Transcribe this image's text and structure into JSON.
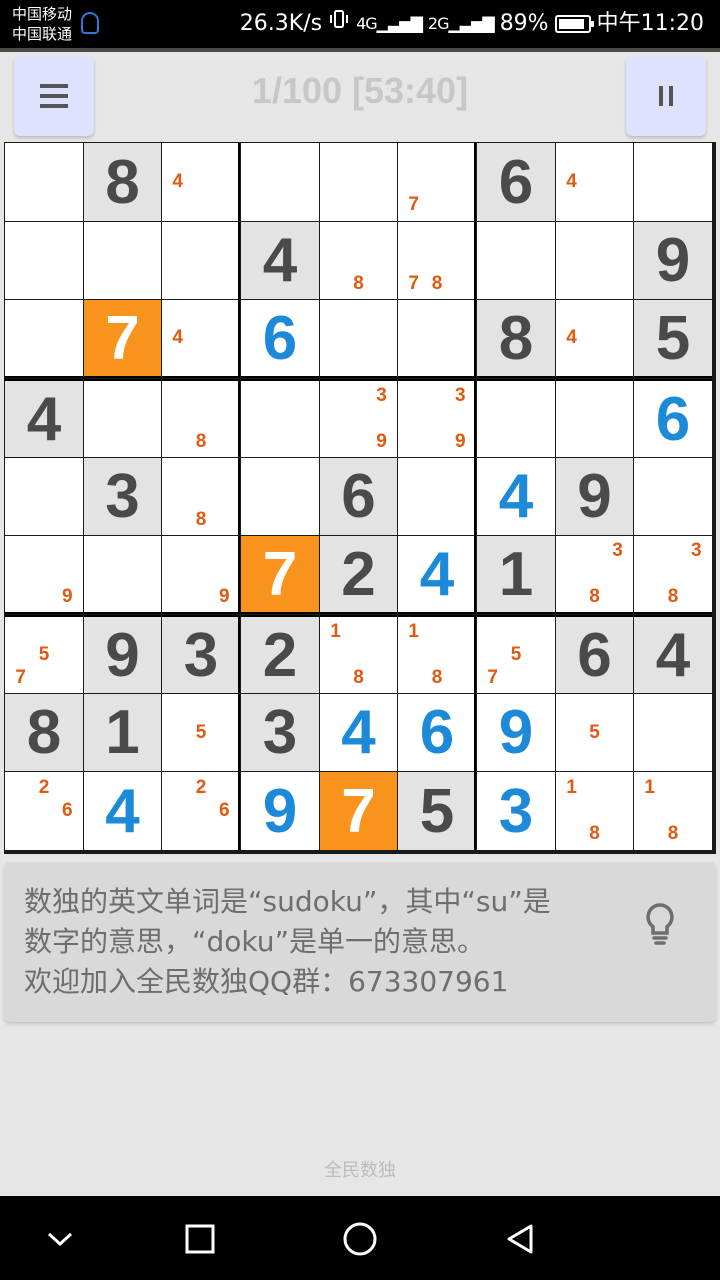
{
  "status_bar": {
    "carrier_1": "中国移动",
    "carrier_2": "中国联通",
    "speed": "26.3K/s",
    "net_1": "4G",
    "net_2": "2G",
    "battery": "89%",
    "battery_level": 0.89,
    "time": "中午11:20"
  },
  "header": {
    "menu_icon": "menu-icon",
    "pause_icon": "pause-icon",
    "title": "1/100 [53:40]"
  },
  "board": {
    "rows": [
      [
        {
          "v": "",
          "t": "empty",
          "n": []
        },
        {
          "v": "8",
          "t": "given",
          "n": []
        },
        {
          "v": "",
          "t": "empty",
          "n": [
            {
              "p": 4,
              "d": "4"
            }
          ]
        },
        {
          "v": "",
          "t": "empty",
          "n": []
        },
        {
          "v": "",
          "t": "empty",
          "n": []
        },
        {
          "v": "",
          "t": "empty",
          "n": [
            {
              "p": 7,
              "d": "7"
            }
          ]
        },
        {
          "v": "6",
          "t": "given",
          "n": []
        },
        {
          "v": "",
          "t": "empty",
          "n": [
            {
              "p": 4,
              "d": "4"
            }
          ]
        },
        {
          "v": "",
          "t": "empty",
          "n": []
        }
      ],
      [
        {
          "v": "",
          "t": "empty",
          "n": []
        },
        {
          "v": "",
          "t": "empty",
          "n": []
        },
        {
          "v": "",
          "t": "empty",
          "n": []
        },
        {
          "v": "4",
          "t": "given",
          "n": []
        },
        {
          "v": "",
          "t": "empty",
          "n": [
            {
              "p": 8,
              "d": "8"
            }
          ]
        },
        {
          "v": "",
          "t": "empty",
          "n": [
            {
              "p": 7,
              "d": "7"
            },
            {
              "p": 8,
              "d": "8"
            }
          ]
        },
        {
          "v": "",
          "t": "empty",
          "n": []
        },
        {
          "v": "",
          "t": "empty",
          "n": []
        },
        {
          "v": "9",
          "t": "given",
          "n": []
        }
      ],
      [
        {
          "v": "",
          "t": "empty",
          "n": []
        },
        {
          "v": "7",
          "t": "highlight",
          "n": []
        },
        {
          "v": "",
          "t": "empty",
          "n": [
            {
              "p": 4,
              "d": "4"
            }
          ]
        },
        {
          "v": "6",
          "t": "user",
          "n": []
        },
        {
          "v": "",
          "t": "empty",
          "n": []
        },
        {
          "v": "",
          "t": "empty",
          "n": []
        },
        {
          "v": "8",
          "t": "given",
          "n": []
        },
        {
          "v": "",
          "t": "empty",
          "n": [
            {
              "p": 4,
              "d": "4"
            }
          ]
        },
        {
          "v": "5",
          "t": "given",
          "n": []
        }
      ],
      [
        {
          "v": "4",
          "t": "given",
          "n": []
        },
        {
          "v": "",
          "t": "empty",
          "n": []
        },
        {
          "v": "",
          "t": "empty",
          "n": [
            {
              "p": 8,
              "d": "8"
            }
          ]
        },
        {
          "v": "",
          "t": "empty",
          "n": []
        },
        {
          "v": "",
          "t": "empty",
          "n": [
            {
              "p": 3,
              "d": "3"
            },
            {
              "p": 9,
              "d": "9"
            }
          ]
        },
        {
          "v": "",
          "t": "empty",
          "n": [
            {
              "p": 3,
              "d": "3"
            },
            {
              "p": 9,
              "d": "9"
            }
          ]
        },
        {
          "v": "",
          "t": "empty",
          "n": []
        },
        {
          "v": "",
          "t": "empty",
          "n": []
        },
        {
          "v": "6",
          "t": "user",
          "n": []
        }
      ],
      [
        {
          "v": "",
          "t": "empty",
          "n": []
        },
        {
          "v": "3",
          "t": "given",
          "n": []
        },
        {
          "v": "",
          "t": "empty",
          "n": [
            {
              "p": 8,
              "d": "8"
            }
          ]
        },
        {
          "v": "",
          "t": "empty",
          "n": []
        },
        {
          "v": "6",
          "t": "given",
          "n": []
        },
        {
          "v": "",
          "t": "empty",
          "n": []
        },
        {
          "v": "4",
          "t": "user",
          "n": []
        },
        {
          "v": "9",
          "t": "given",
          "n": []
        },
        {
          "v": "",
          "t": "empty",
          "n": []
        }
      ],
      [
        {
          "v": "",
          "t": "empty",
          "n": [
            {
              "p": 9,
              "d": "9"
            }
          ]
        },
        {
          "v": "",
          "t": "empty",
          "n": []
        },
        {
          "v": "",
          "t": "empty",
          "n": [
            {
              "p": 9,
              "d": "9"
            }
          ]
        },
        {
          "v": "7",
          "t": "highlight",
          "n": []
        },
        {
          "v": "2",
          "t": "given",
          "n": []
        },
        {
          "v": "4",
          "t": "user",
          "n": []
        },
        {
          "v": "1",
          "t": "given",
          "n": []
        },
        {
          "v": "",
          "t": "empty",
          "n": [
            {
              "p": 3,
              "d": "3"
            },
            {
              "p": 8,
              "d": "8"
            }
          ]
        },
        {
          "v": "",
          "t": "empty",
          "n": [
            {
              "p": 3,
              "d": "3"
            },
            {
              "p": 8,
              "d": "8"
            }
          ]
        }
      ],
      [
        {
          "v": "",
          "t": "empty",
          "n": [
            {
              "p": 5,
              "d": "5"
            },
            {
              "p": 7,
              "d": "7"
            }
          ]
        },
        {
          "v": "9",
          "t": "given",
          "n": []
        },
        {
          "v": "3",
          "t": "given",
          "n": []
        },
        {
          "v": "2",
          "t": "given",
          "n": []
        },
        {
          "v": "",
          "t": "empty",
          "n": [
            {
              "p": 1,
              "d": "1"
            },
            {
              "p": 8,
              "d": "8"
            }
          ]
        },
        {
          "v": "",
          "t": "empty",
          "n": [
            {
              "p": 1,
              "d": "1"
            },
            {
              "p": 8,
              "d": "8"
            }
          ]
        },
        {
          "v": "",
          "t": "empty",
          "n": [
            {
              "p": 5,
              "d": "5"
            },
            {
              "p": 7,
              "d": "7"
            }
          ]
        },
        {
          "v": "6",
          "t": "given",
          "n": []
        },
        {
          "v": "4",
          "t": "given",
          "n": []
        }
      ],
      [
        {
          "v": "8",
          "t": "given",
          "n": []
        },
        {
          "v": "1",
          "t": "given",
          "n": []
        },
        {
          "v": "",
          "t": "empty",
          "n": [
            {
              "p": 5,
              "d": "5"
            }
          ]
        },
        {
          "v": "3",
          "t": "given",
          "n": []
        },
        {
          "v": "4",
          "t": "user",
          "n": []
        },
        {
          "v": "6",
          "t": "user",
          "n": []
        },
        {
          "v": "9",
          "t": "user",
          "n": []
        },
        {
          "v": "",
          "t": "empty",
          "n": [
            {
              "p": 5,
              "d": "5"
            }
          ]
        },
        {
          "v": "",
          "t": "empty",
          "n": []
        }
      ],
      [
        {
          "v": "",
          "t": "empty",
          "n": [
            {
              "p": 2,
              "d": "2"
            },
            {
              "p": 6,
              "d": "6"
            }
          ]
        },
        {
          "v": "4",
          "t": "user",
          "n": []
        },
        {
          "v": "",
          "t": "empty",
          "n": [
            {
              "p": 2,
              "d": "2"
            },
            {
              "p": 6,
              "d": "6"
            }
          ]
        },
        {
          "v": "9",
          "t": "user",
          "n": []
        },
        {
          "v": "7",
          "t": "highlight",
          "n": []
        },
        {
          "v": "5",
          "t": "given",
          "n": []
        },
        {
          "v": "3",
          "t": "user",
          "n": []
        },
        {
          "v": "",
          "t": "empty",
          "n": [
            {
              "p": 1,
              "d": "1"
            },
            {
              "p": 8,
              "d": "8"
            }
          ]
        },
        {
          "v": "",
          "t": "empty",
          "n": [
            {
              "p": 1,
              "d": "1"
            },
            {
              "p": 8,
              "d": "8"
            }
          ]
        }
      ]
    ]
  },
  "tip": {
    "text": "数独的英文单词是“sudoku”，其中“su”是\n数字的意思，“doku”是单一的意思。\n欢迎加入全民数独QQ群：673307961",
    "icon": "lightbulb-icon"
  },
  "footer": {
    "label": "全民数独"
  },
  "nav_bar": {
    "back_icon": "back-icon",
    "home_icon": "home-icon",
    "recents_icon": "recents-icon",
    "collapse_icon": "chevron-down-icon"
  },
  "colors": {
    "given_bg": "#e3e3e3",
    "highlight_bg": "#f8941d",
    "user_digit": "#1c8ad8",
    "given_digit": "#4a4a4a",
    "note_digit": "#e05a10",
    "button_bg": "#e0e0ff"
  }
}
